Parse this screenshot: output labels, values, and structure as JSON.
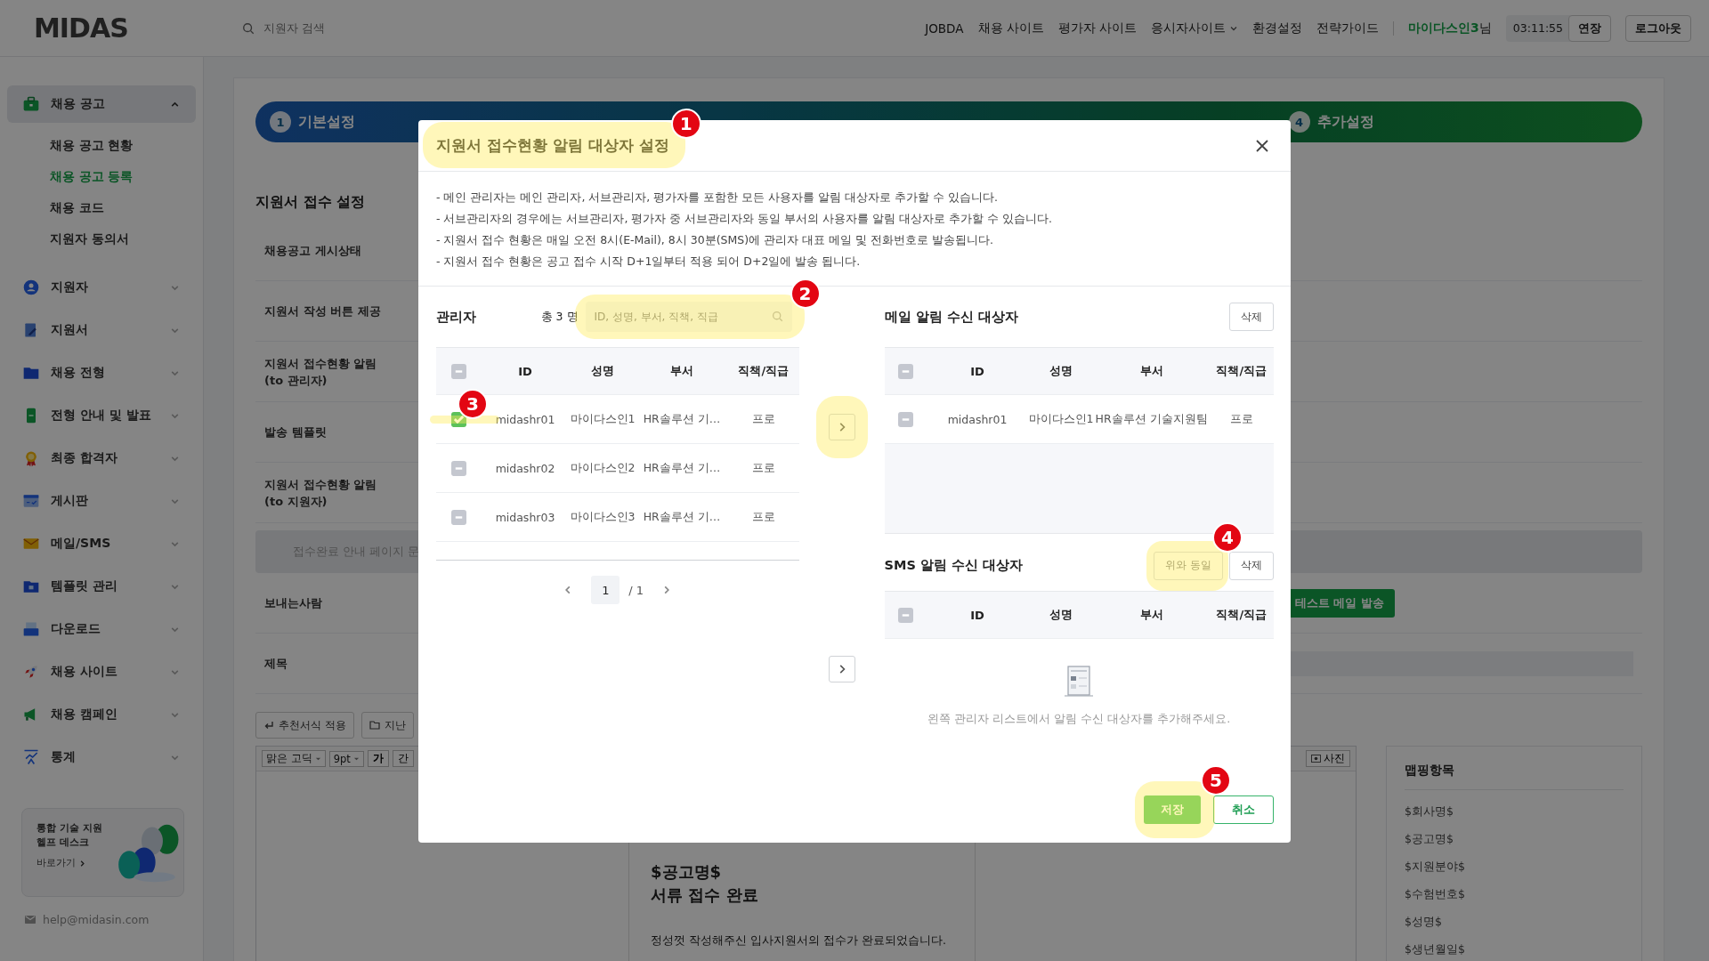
{
  "header": {
    "logo": "MIDAS",
    "search": {
      "placeholder": "지원자 검색"
    },
    "nav": [
      {
        "label": "JOBDA",
        "dropdown": false
      },
      {
        "label": "채용 사이트",
        "dropdown": false
      },
      {
        "label": "평가자 사이트",
        "dropdown": false
      },
      {
        "label": "응시자사이트",
        "dropdown": true
      },
      {
        "label": "환경설정",
        "dropdown": false
      },
      {
        "label": "전략가이드",
        "dropdown": false
      }
    ],
    "user_name": "마이다스인3",
    "user_suffix": "님",
    "timer": "03:11:55",
    "extend_button": "연장",
    "logout_button": "로그아웃"
  },
  "sidebar": {
    "items": [
      {
        "label": "채용 공고",
        "expanded": true,
        "children": [
          {
            "label": "채용 공고 현황",
            "selected": false
          },
          {
            "label": "채용 공고 등록",
            "selected": true
          },
          {
            "label": "채용 코드",
            "selected": false
          },
          {
            "label": "지원자 동의서",
            "selected": false
          }
        ]
      },
      {
        "label": "지원자",
        "expanded": false
      },
      {
        "label": "지원서",
        "expanded": false
      },
      {
        "label": "채용 전형",
        "expanded": false
      },
      {
        "label": "전형 안내 및 발표",
        "expanded": false
      },
      {
        "label": "최종 합격자",
        "expanded": false
      },
      {
        "label": "게시판",
        "expanded": false
      },
      {
        "label": "메일/SMS",
        "expanded": false
      },
      {
        "label": "템플릿 관리",
        "expanded": false
      },
      {
        "label": "다운로드",
        "expanded": false
      },
      {
        "label": "채용 사이트",
        "expanded": false
      },
      {
        "label": "채용 캠페인",
        "expanded": false
      },
      {
        "label": "통계",
        "expanded": false
      }
    ],
    "help_card": {
      "title": "통합 기술 지원\n헬프 데스크",
      "link": "바로가기"
    },
    "email": "help@midasin.com"
  },
  "steps": [
    {
      "number": "1",
      "label": "기본설정"
    },
    {
      "number": "4",
      "label": "추가설정"
    }
  ],
  "form": {
    "title": "지원서 접수 설정",
    "rows": [
      {
        "label": "채용공고 게시상태"
      },
      {
        "label": "지원서 작성 버튼 제공"
      },
      {
        "label": "지원서 접수현황 알림\n(to 관리자)"
      },
      {
        "label": "발송 템플릿"
      },
      {
        "label": "지원서 접수현황 알림\n(to 지원자)"
      }
    ],
    "page_button": "접수완료 안내 페이지 문",
    "sender_label": "보내는사람",
    "test_mail_button": "테스트 메일 발송",
    "subject_label": "제목",
    "template_button": "추천서식 적용",
    "past_button": "지난",
    "editor": {
      "font": "맑은 고딕",
      "size": "9pt",
      "bold": "가",
      "italic": "간",
      "photo_button": "사진",
      "preview": {
        "heading": "$공고명$",
        "subheading": "서류 접수 완료",
        "body": "정성껏 작성해주신 입사지원서의 접수가 완료되었습니다."
      }
    },
    "mapping": {
      "title": "맵핑항목",
      "items": [
        "$회사명$",
        "$공고명$",
        "$지원분야$",
        "$수험번호$",
        "$성명$",
        "$생년월일$"
      ]
    }
  },
  "modal": {
    "title": "지원서 접수현황 알림 대상자 설정",
    "notes": [
      "- 메인 관리자는 메인 관리자, 서브관리자, 평가자를 포함한 모든 사용자를 알림 대상자로 추가할 수 있습니다.",
      "- 서브관리자의 경우에는 서브관리자, 평가자 중 서브관리자와 동일 부서의 사용자를 알림 대상자로 추가할 수 있습니다.",
      "- 지원서 접수 현황은 매일 오전 8시(E-Mail), 8시 30분(SMS)에 관리자 대표 메일 및 전화번호로 발송됩니다.",
      "- 지원서 접수 현황은 공고 접수 시작 D+1일부터 적용 되어 D+2일에 발송 됩니다."
    ],
    "admins": {
      "title": "관리자",
      "count": "총 3 명",
      "search": {
        "placeholder": "ID, 성명, 부서, 직책, 직급"
      },
      "columns": [
        "ID",
        "성명",
        "부서",
        "직책/직급"
      ],
      "all_checked": false,
      "rows": [
        {
          "checked": true,
          "cells": [
            "midashr01",
            "마이다스인1",
            "HR솔루션 기…",
            "프로"
          ]
        },
        {
          "checked": false,
          "cells": [
            "midashr02",
            "마이다스인2",
            "HR솔루션 기…",
            "프로"
          ]
        },
        {
          "checked": false,
          "cells": [
            "midashr03",
            "마이다스인3",
            "HR솔루션 기…",
            "프로"
          ]
        }
      ],
      "pagination": {
        "current": "1",
        "total": "/ 1"
      }
    },
    "mail": {
      "title": "메일 알림 수신 대상자",
      "delete_button": "삭제",
      "columns": [
        "ID",
        "성명",
        "부서",
        "직책/직급"
      ],
      "all_checked": false,
      "rows": [
        {
          "checked": false,
          "cells": [
            "midashr01",
            "마이다스인1",
            "HR솔루션 기술지원팀",
            "프로"
          ]
        }
      ]
    },
    "sms": {
      "title": "SMS 알림 수신 대상자",
      "same_button": "위와 동일",
      "delete_button": "삭제",
      "columns": [
        "ID",
        "성명",
        "부서",
        "직책/직급"
      ],
      "all_checked": false,
      "empty_message": "왼쪽 관리자 리스트에서 알림 수신 대상자를 추가해주세요."
    },
    "save_button": "저장",
    "cancel_button": "취소"
  },
  "callouts": [
    "1",
    "2",
    "3",
    "4",
    "5"
  ]
}
